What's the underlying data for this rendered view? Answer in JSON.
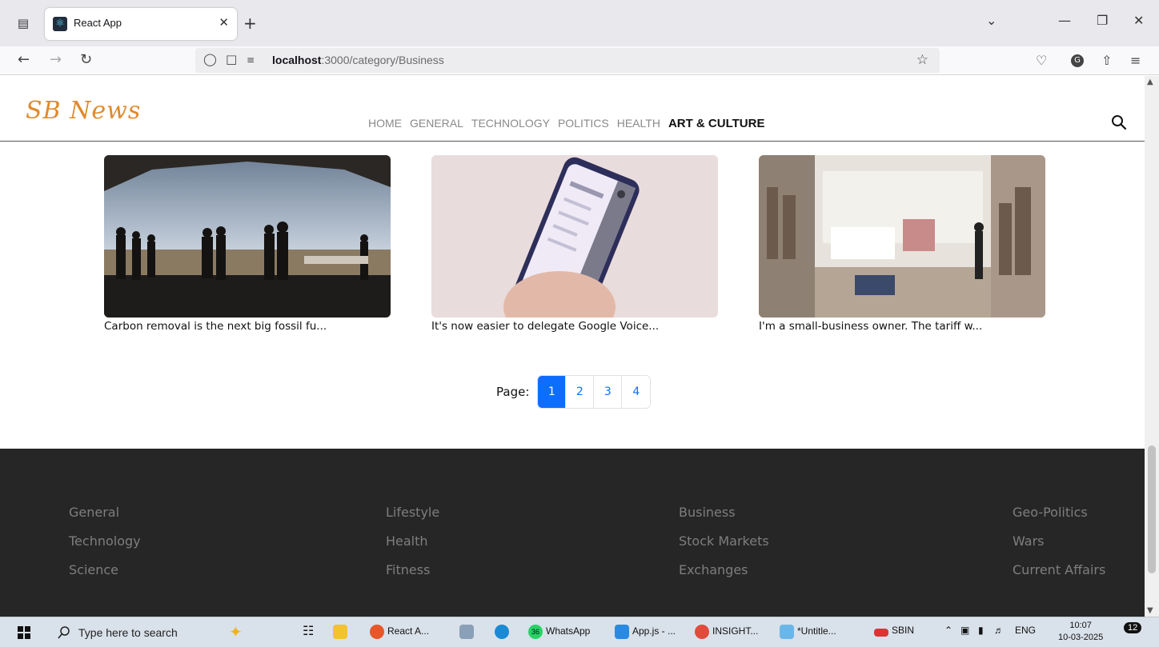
{
  "browser": {
    "tab_title": "React App",
    "url_host": "localhost",
    "url_path": ":3000/category/Business"
  },
  "site": {
    "logo": "SB News",
    "nav": [
      {
        "label": "HOME",
        "active": false
      },
      {
        "label": "GENERAL",
        "active": false
      },
      {
        "label": "TECHNOLOGY",
        "active": false
      },
      {
        "label": "POLITICS",
        "active": false
      },
      {
        "label": "HEALTH",
        "active": false
      },
      {
        "label": "ART & CULTURE",
        "active": true
      }
    ]
  },
  "articles": [
    {
      "title": "Carbon removal is the next big fossil fu..."
    },
    {
      "title": "It's now easier to delegate Google Voice..."
    },
    {
      "title": "I'm a small-business owner. The tariff w..."
    }
  ],
  "pagination": {
    "label": "Page:",
    "pages": [
      "1",
      "2",
      "3",
      "4"
    ],
    "current": "1"
  },
  "footer": {
    "columns": [
      [
        "General",
        "Technology",
        "Science"
      ],
      [
        "Lifestyle",
        "Health",
        "Fitness"
      ],
      [
        "Business",
        "Stock Markets",
        "Exchanges"
      ],
      [
        "Geo-Politics",
        "Wars",
        "Current Affairs"
      ]
    ]
  },
  "taskbar": {
    "search_placeholder": "Type here to search",
    "items": {
      "firefox": "React A...",
      "whatsapp": "WhatsApp",
      "whatsapp_badge": "36",
      "vscode": "App.js - ...",
      "chrome": "INSIGHT...",
      "paint": "*Untitle...",
      "stock": "SBIN",
      "lang": "ENG"
    },
    "time": "10:07",
    "date": "10-03-2025",
    "notifications": "12"
  },
  "colors": {
    "accent": "#0d6efd",
    "logo": "#e08a2c",
    "footer_bg": "#262626"
  }
}
